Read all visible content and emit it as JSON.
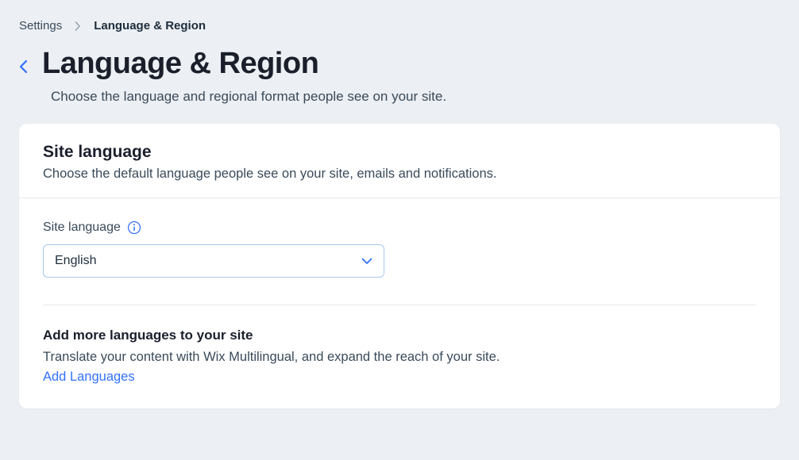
{
  "breadcrumb": {
    "parent": "Settings",
    "current": "Language & Region"
  },
  "header": {
    "title": "Language & Region",
    "subtitle": "Choose the language and regional format people see on your site."
  },
  "card": {
    "title": "Site language",
    "subtitle": "Choose the default language people see on your site, emails and notifications.",
    "field_label": "Site language",
    "selected_language": "English",
    "multilingual": {
      "title": "Add more languages to your site",
      "description": "Translate your content with Wix Multilingual, and expand the reach of your site.",
      "link_text": "Add Languages"
    }
  }
}
